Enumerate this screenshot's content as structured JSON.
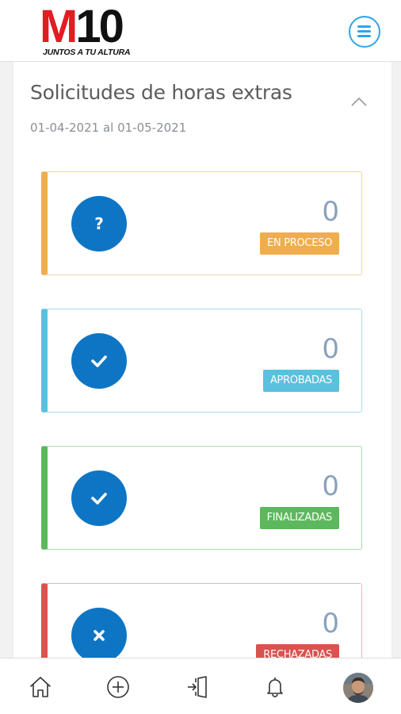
{
  "header": {
    "logo_main_m": "M",
    "logo_main_num": "10",
    "logo_tagline": "JUNTOS A TU ALTURA",
    "menu_icon": "hamburger-icon"
  },
  "summary": {
    "title": "Solicitudes de horas extras",
    "date_range": "01-04-2021 al 01-05-2021",
    "collapse_icon": "chevron-up-icon"
  },
  "statuses": [
    {
      "label": "EN PROCESO",
      "count": "0",
      "icon": "question-icon",
      "color": "#f0ad4e",
      "border": "#f7d2a6"
    },
    {
      "label": "APROBADAS",
      "count": "0",
      "icon": "check-icon",
      "color": "#5bc0de",
      "border": "#a9dcec"
    },
    {
      "label": "FINALIZADAS",
      "count": "0",
      "icon": "check-icon",
      "color": "#5cb85c",
      "border": "#aed9ae"
    },
    {
      "label": "RECHAZADAS",
      "count": "0",
      "icon": "close-icon",
      "color": "#d9534f",
      "border": "#eeb3b1"
    }
  ],
  "colors": {
    "icon_circle": "#0e75c4",
    "accent": "#2fa4e7",
    "count_text": "#8aa2bc"
  },
  "bottom_nav": [
    {
      "icon": "home-icon"
    },
    {
      "icon": "plus-circle-icon"
    },
    {
      "icon": "door-exit-icon"
    },
    {
      "icon": "bell-icon"
    },
    {
      "icon": "user-avatar"
    }
  ]
}
